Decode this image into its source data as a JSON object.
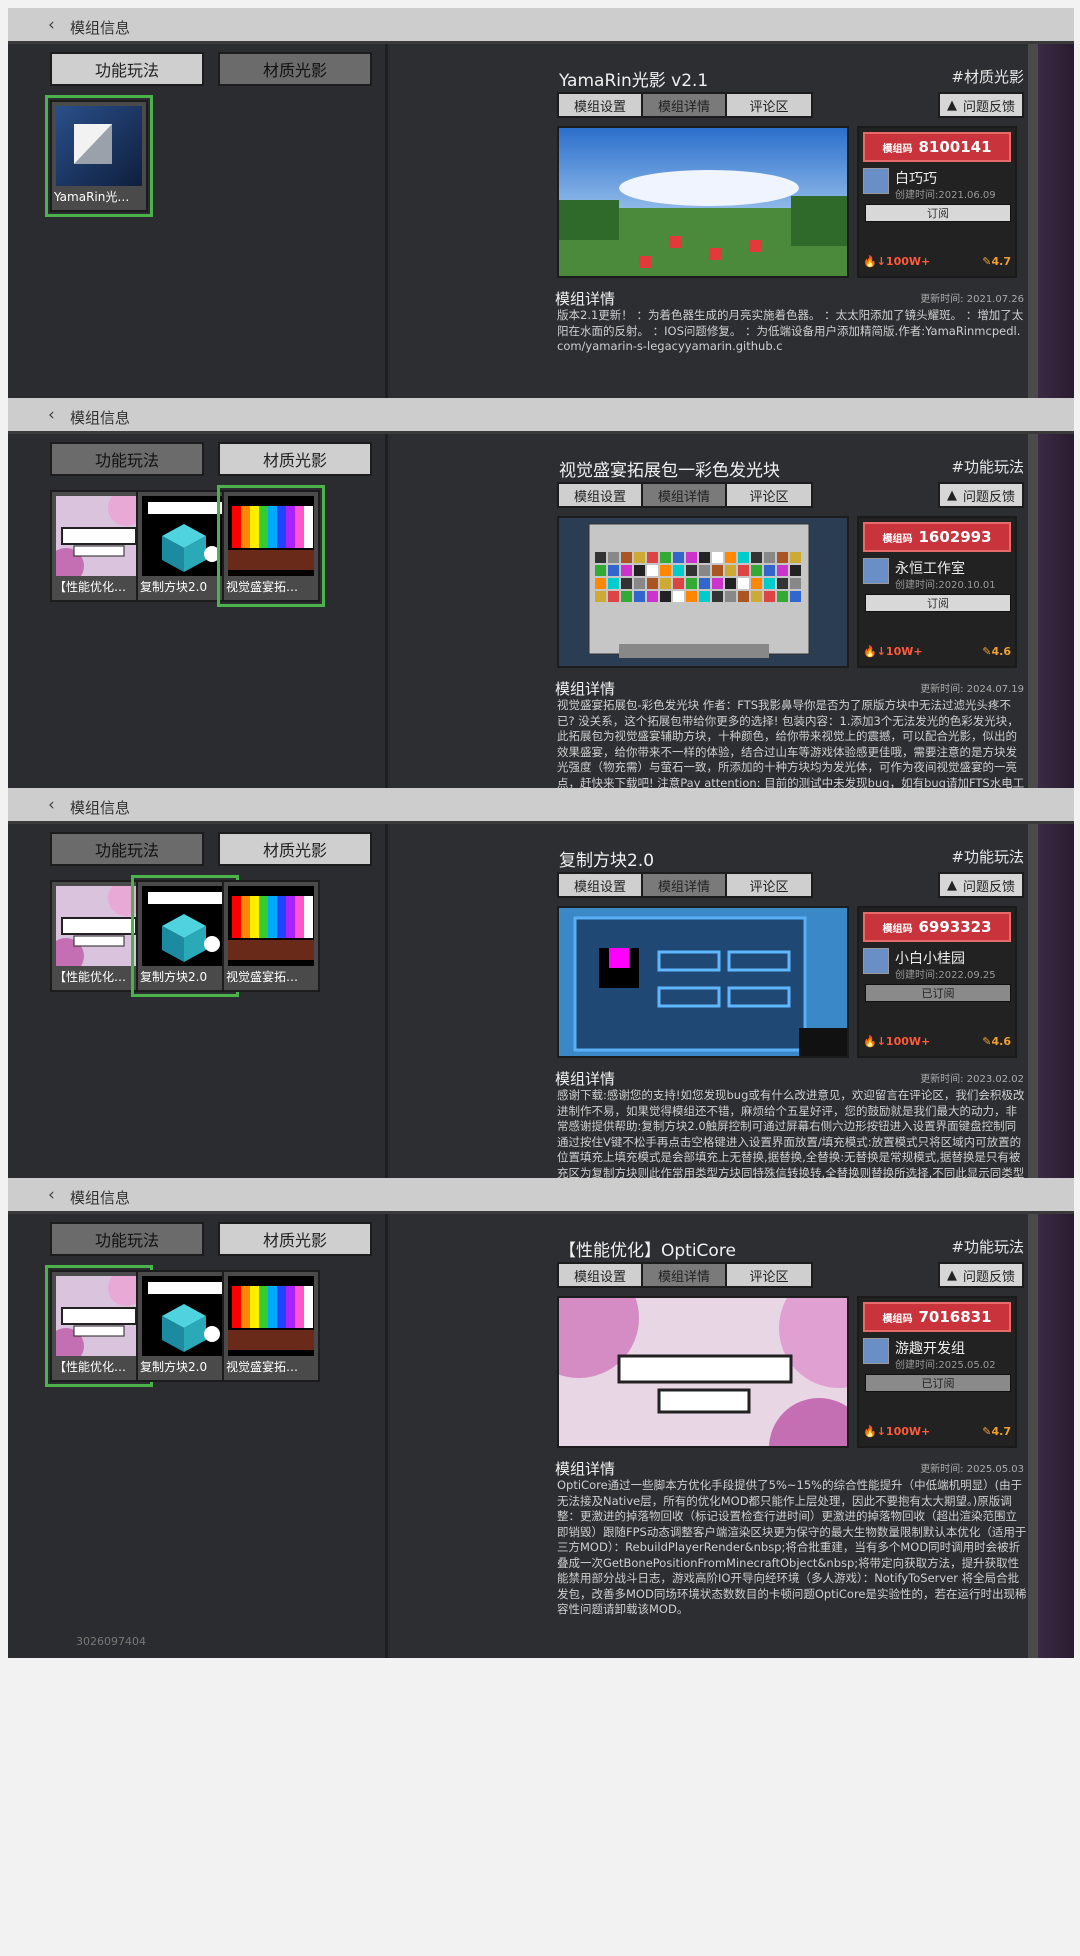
{
  "header": {
    "back_icon": "‹",
    "title": "模组信息"
  },
  "left_tabs": [
    "功能玩法",
    "材质光影"
  ],
  "version": "3026097404",
  "right_tabs": [
    "模组设置",
    "模组详情",
    "评论区"
  ],
  "feedback": "问题反馈",
  "detail_heading": "模组详情",
  "code_label": "模组码",
  "panels": [
    {
      "active_left_tab": 1,
      "cards": [
        {
          "label": "YamaRin光…",
          "thumb": "yamarin"
        }
      ],
      "title": "YamaRin光影 v2.1",
      "category": "#材质光影",
      "code": "8100141",
      "author": "白巧巧",
      "created": "创建时间:2021.06.09",
      "subscribe": "订阅",
      "subscribed": false,
      "hot": "100W+",
      "rating": "4.7",
      "updated": "更新时间: 2021.07.26",
      "desc": "版本2.1更新！ ：为着色器生成的月亮实施着色器。 ：太太阳添加了镜头耀斑。 ：增加了太阳在水面的反射。 ：IOS问题修复。 ：为低端设备用户添加精简版.作者:YamaRinmcpedl. com/yamarin-s-legacyyamarin.github.c"
    },
    {
      "active_left_tab": 0,
      "cards": [
        {
          "label": "【性能优化…",
          "thumb": "opti"
        },
        {
          "label": "复制方块2.0",
          "thumb": "cube"
        },
        {
          "label": "视觉盛宴拓…",
          "thumb": "rainbow"
        }
      ],
      "selected_card": 2,
      "title": "视觉盛宴拓展包一彩色发光块",
      "category": "#功能玩法",
      "code": "1602993",
      "author": "永恒工作室",
      "created": "创建时间:2020.10.01",
      "subscribe": "订阅",
      "subscribed": false,
      "hot": "10W+",
      "rating": "4.6",
      "updated": "更新时间: 2024.07.19",
      "desc": "视觉盛宴拓展包-彩色发光块 作者：FTS我影鼻导你是否为了原版方块中无法过滤光头疼不已? 没关系，这个拓展包带给你更多的选择! 包装内容：1.添加3个无法发光的色彩发光块，此拓展包为视觉盛宴辅助方块，十种颜色，给你带来视觉上的震撼，可以配合光影，似出的效果盛宴，给你带来不一样的体验，结合过山车等游戏体验感更佳哦，需要注意的是方块发光强度（物充需）与萤石一致，所添加的十种方块均为发光体，可作为夜间视觉盛宴的一亮点，赶快来下载吧! 注意Pay attention: 目前的测试中未发现bug，如有bug请加FTS水电工作室交流群:735249834反映。加入我们一起开拓该加群：685974603方块位置：（拒绝回找不到方块而老详）任心的我们为您提供几个想法和灵感：1.与朋友一起玩过山车，体验视觉冲击。2.在建筑中的光影事件，为您的玩家提供多彩光源3.可用在区域性亮化照明，结合玻璃使用做出令人惊叹的效果；4.商业区的广告或招牌也可使用。更新：添加6mod所有彩色发光块的合成公式部分彩色发光块游戏内工作台合成公式如下：其他颜色的发光块以此类推(合成公式图)"
    },
    {
      "active_left_tab": 0,
      "cards": [
        {
          "label": "【性能优化…",
          "thumb": "opti"
        },
        {
          "label": "复制方块2.0",
          "thumb": "cube"
        },
        {
          "label": "视觉盛宴拓…",
          "thumb": "rainbow"
        }
      ],
      "selected_card": 1,
      "title": "复制方块2.0",
      "category": "#功能玩法",
      "code": "6993323",
      "author": "小白小桂园",
      "created": "创建时间:2022.09.25",
      "subscribe": "已订阅",
      "subscribed": true,
      "hot": "100W+",
      "rating": "4.6",
      "updated": "更新时间: 2023.02.02",
      "desc": "感谢下载:感谢您的支持!如您发现bug或有什么改进意见，欢迎留言在评论区，我们会积极改进制作不易，如果觉得模组还不错，麻烦给个五星好评，您的鼓励就是我们最大的动力，非常感谢提供帮助:复制方块2.0触屏控制可通过屏幕右侧六边形按钮进入设置界面键盘控制同通过按住V键不松手再点击空格键进入设置界面放置/填充模式:放置模式只将区域内可放置的位置填充上填充模式是会部填充上无替换,据替换,全替换:无替换是常规模式,据替换是只有被充区为复制方块则此作常用类型方块同特殊信转换转,全替换则替换所选择,不同此显示同类型就行心心,小心实心是将选充区每个位置都填充一遍,空心只填充外围一遍,如果选充区域有精被区为用复制方形空心圈复制上,复制下:复制上是将填充填充为复制方块上面的方块,复制下说是填充复制方块下边的方块复杂说明:每次复制不可超过区域包围盒大小上限65535,复制方块都不可消耗鉴生存复制会消耗背包物品如果没有不填充,生存单次填充空气只能填充64格复制极限上此方只允许填一次使用,玩家第一次进入为默认，魔主可进行复制权限方块去上角设置默认模式，也可单"
    },
    {
      "active_left_tab": 0,
      "cards": [
        {
          "label": "【性能优化…",
          "thumb": "opti"
        },
        {
          "label": "复制方块2.0",
          "thumb": "cube"
        },
        {
          "label": "视觉盛宴拓…",
          "thumb": "rainbow"
        }
      ],
      "selected_card": 0,
      "title": "【性能优化】OptiCore",
      "category": "#功能玩法",
      "code": "7016831",
      "author": "游趣开发组",
      "created": "创建时间:2025.05.02",
      "subscribe": "已订阅",
      "subscribed": true,
      "hot": "100W+",
      "rating": "4.7",
      "updated": "更新时间: 2025.05.03",
      "desc": "OptiCore通过一些脚本方优化手段提供了5%~15%的综合性能提升（中低端机明显）(由于无法接及Native层，所有的优化MOD都只能作上层处理，因此不要抱有太大期望。)原版调整：更激进的掉落物回收（标记设置检查行进时间）更激进的掉落物回收（超出渲染范围立即销毁）跟随FPS动态调整客户端渲染区块更为保守的最大生物数量限制默认本优化（适用于三方MOD）：RebuildPlayerRender&nbsp;将合批重建，当有多个MOD同时调用时会被折叠成一次GetBonePositionFromMinecraftObject&nbsp;将带定向获取方法，提升获取性能禁用部分战斗日志，游戏高阶IO开导向经环境（多人游戏）：NotifyToServer 将全局合批发包，改善多MOD同场环境状态数数目的卡顿问题OptiCore是实验性的，若在运行时出现稀容性问题请卸载该MOD。"
    }
  ]
}
